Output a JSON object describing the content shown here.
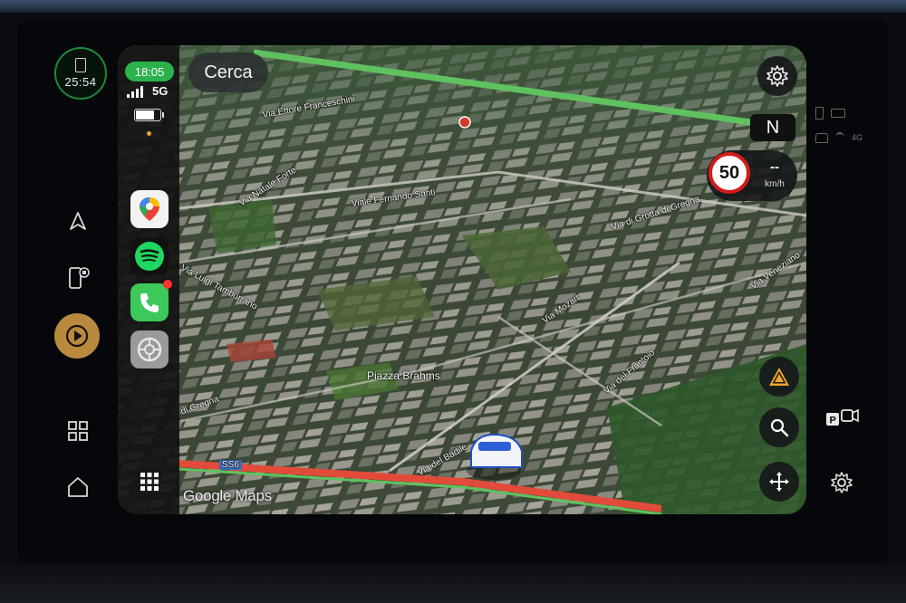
{
  "car_rail": {
    "clock": "25:54",
    "icons": [
      "clock-phone-icon",
      "navigation-arrow-icon",
      "phone-projection-icon",
      "carplay-play-icon",
      "grid-apps-icon",
      "home-icon"
    ]
  },
  "status": {
    "time": "18:05",
    "network": "5G"
  },
  "dock": {
    "apps": [
      "google-maps-icon",
      "spotify-icon",
      "phone-icon",
      "settings-icon",
      "app-grid-icon"
    ]
  },
  "map": {
    "search_label": "Cerca",
    "compass": "N",
    "speed_limit": "50",
    "current_speed": "--",
    "speed_unit": "km/h",
    "attribution": "Google Maps",
    "road_shield": "SS6",
    "streets": {
      "s1": "Via Ettore Franceschini",
      "s2": "Viale Fernando Santi",
      "s3": "Via di Grotta di Gregna",
      "s4": "Via Luigi Tamburrano",
      "s5": "Via Mozart",
      "s6": "Piazza Brahms",
      "s7": "Via del Frantoio",
      "s8": "di Gregna",
      "s9": "Via del Badile",
      "s10": "Via Veneziano",
      "s11": "Via Natale Forte"
    }
  },
  "right_rail": {
    "network": "4G",
    "icons": [
      "parking-camera-icon",
      "settings-gear-icon"
    ]
  },
  "colors": {
    "accent_green": "#2bb24c",
    "speed_ring": "#d21c1c",
    "carplay_gold": "#b98a3e"
  }
}
